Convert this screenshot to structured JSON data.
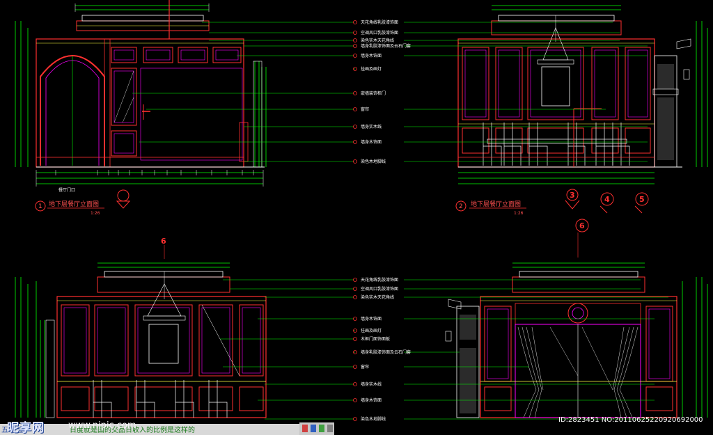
{
  "elevation_1": {
    "number": "1",
    "title": "地下层餐厅立面图",
    "scale": "1:26",
    "door_label": "餐厅门口"
  },
  "elevation_2": {
    "number": "2",
    "title": "地下层餐厅立面图",
    "scale": "1:26"
  },
  "section_markers": [
    "3",
    "4",
    "5",
    "6"
  ],
  "top_callouts": [
    "天花角线乳胶漆饰面",
    "空调风口乳胶漆饰面",
    "染色实木天花角线",
    "墙身乳胶漆饰面及云石门套",
    "墙身木饰面",
    "挂画及画灯",
    "嵌墙装饰柜门",
    "窗帘",
    "墙身实木线",
    "墙身木饰面",
    "染色木地脚线"
  ],
  "bottom_callouts": [
    "天花角线乳胶漆饰面",
    "空调风口乳胶漆饰面",
    "染色实木天花角线",
    "墙身木饰面",
    "挂画及画灯",
    "木框门面饰面板",
    "墙身乳胶漆饰面及云石门套",
    "窗帘",
    "墙身实木线",
    "墙身木饰面",
    "染色木地脚线"
  ],
  "watermark": {
    "brand": "昵享网",
    "url": "www.nipic.com",
    "id": "ID:2823451 NO:20110625220920692000",
    "strip_left": "五笔 全",
    "strip_text": "日度就是国的交品日收入的比例是这样的"
  },
  "colors": {
    "background": "#000000",
    "wall_outline": "#ff3030",
    "panel_inner": "#ff00ff",
    "callout_line": "#00ff00",
    "dimension": "#ffffff",
    "trim": "#ffff40"
  }
}
